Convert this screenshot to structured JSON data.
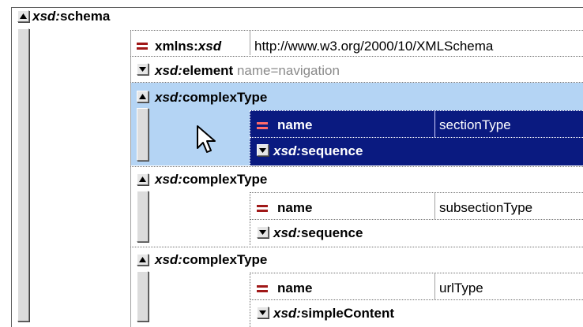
{
  "root": {
    "prefix": "xsd:",
    "name": "schema"
  },
  "attribute": {
    "prefix_plain": "xmlns:",
    "prefix_italic": "xsd",
    "value": "http://www.w3.org/2000/10/XMLSchema"
  },
  "element": {
    "prefix": "xsd:",
    "name": "element",
    "hint": "name=navigation"
  },
  "complex_types": [
    {
      "prefix": "xsd:",
      "name": "complexType",
      "attr_name": "name",
      "attr_value": "sectionType",
      "child_prefix": "xsd:",
      "child_name": "sequence"
    },
    {
      "prefix": "xsd:",
      "name": "complexType",
      "attr_name": "name",
      "attr_value": "subsectionType",
      "child_prefix": "xsd:",
      "child_name": "sequence"
    },
    {
      "prefix": "xsd:",
      "name": "complexType",
      "attr_name": "name",
      "attr_value": "urlType",
      "child_prefix": "xsd:",
      "child_name": "simpleContent"
    }
  ],
  "colors": {
    "selection_light": "#b4d4f4",
    "selection_dark": "#0a1a80",
    "attribute_marker": "#a01818"
  },
  "icons": {
    "expand": "triangle-up-icon",
    "collapse": "triangle-down-icon",
    "attribute": "equals-icon",
    "pointer": "mouse-cursor-icon"
  }
}
